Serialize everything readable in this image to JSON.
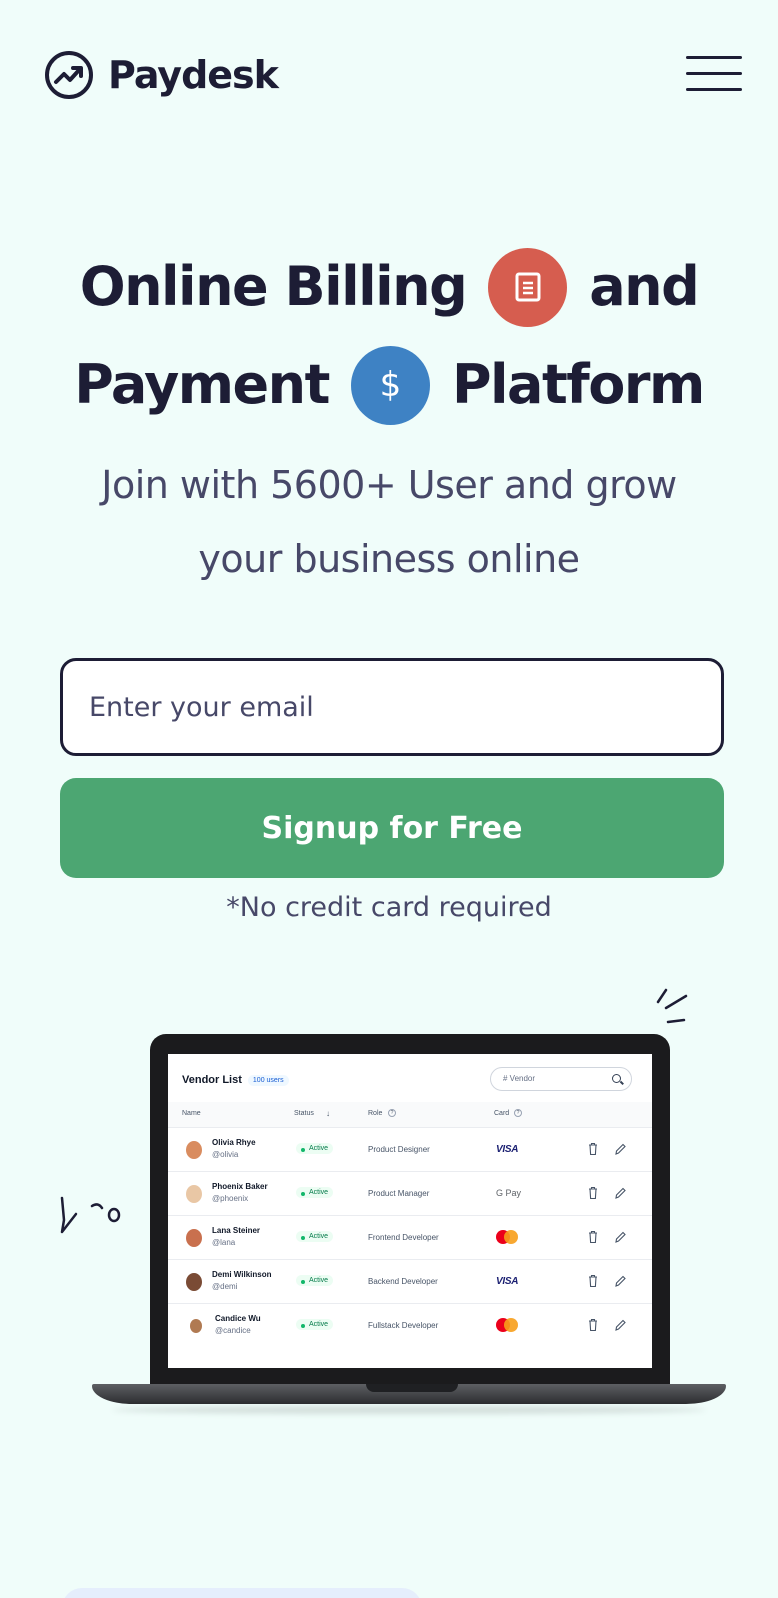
{
  "header": {
    "logo_text": "Paydesk",
    "menu_icon": "hamburger-menu-icon"
  },
  "hero": {
    "line1_word1": "Online Billing",
    "line1_word2": "and",
    "line2_word1": "Payment",
    "line2_word2": "Platform",
    "badge1_icon": "document-icon",
    "badge2_icon": "dollar-icon",
    "badge2_glyph": "$",
    "badge1_color": "#d65d4f",
    "badge2_color": "#3e82c4"
  },
  "subtitle": "Join with 5600+ User and grow your business online",
  "signup": {
    "email_placeholder": "Enter your email",
    "button_label": "Signup for Free",
    "button_color": "#4ca672",
    "note": "*No credit card required"
  },
  "vendor_table": {
    "title": "Vendor List",
    "count_badge": "100 users",
    "search_placeholder": "# Vendor",
    "columns": [
      "Name",
      "Status",
      "Role",
      "Card"
    ],
    "rows": [
      {
        "name": "Olivia Rhye",
        "handle": "@olivia",
        "status": "Active",
        "role": "Product Designer",
        "card": "VISA"
      },
      {
        "name": "Phoenix Baker",
        "handle": "@phoenix",
        "status": "Active",
        "role": "Product Manager",
        "card": "G Pay"
      },
      {
        "name": "Lana Steiner",
        "handle": "@lana",
        "status": "Active",
        "role": "Frontend Developer",
        "card": "mastercard"
      },
      {
        "name": "Demi Wilkinson",
        "handle": "@demi",
        "status": "Active",
        "role": "Backend Developer",
        "card": "VISA"
      },
      {
        "name": "Candice Wu",
        "handle": "@candice",
        "status": "Active",
        "role": "Fullstack Developer",
        "card": "mastercard"
      }
    ]
  }
}
